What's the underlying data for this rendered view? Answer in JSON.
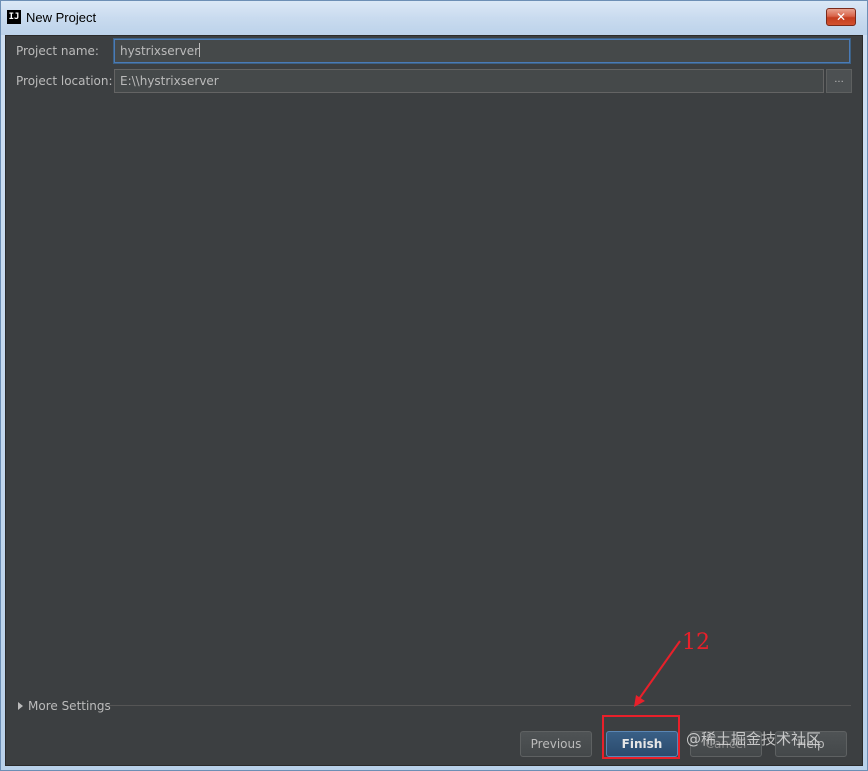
{
  "window": {
    "title": "New Project",
    "app_icon_text": "IJ",
    "close_glyph": "✕"
  },
  "form": {
    "project_name_label": "Project name:",
    "project_name_value": "hystrixserver",
    "project_location_label": "Project location:",
    "project_location_value": "E:\\\\hystrixserver",
    "browse_label": "..."
  },
  "more_settings": {
    "label": "More Settings",
    "icon": "expand-triangle-icon"
  },
  "buttons": {
    "previous": "Previous",
    "finish": "Finish",
    "cancel": "Cancel",
    "help": "Help"
  },
  "annotation": {
    "step_number": "12",
    "color": "#e8202a"
  },
  "watermark": "@稀土掘金技术社区",
  "colors": {
    "panel_bg": "#3c3f41",
    "field_bg": "#45494a",
    "text": "#bbbbbb",
    "focus": "#4a7bb7",
    "default_button": "#365880"
  }
}
